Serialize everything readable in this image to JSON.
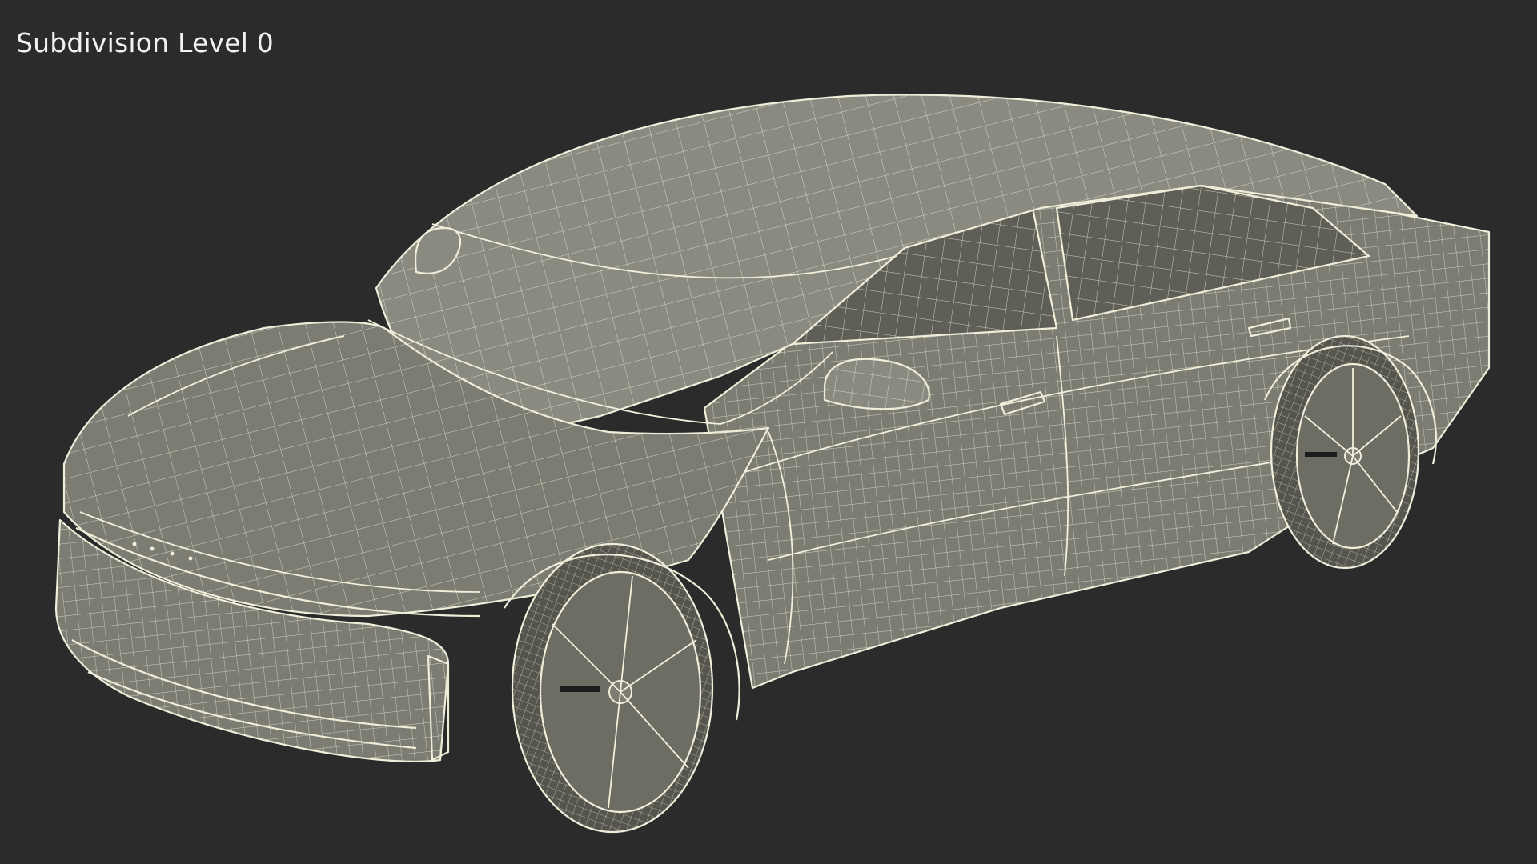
{
  "viewport": {
    "label": "Subdivision Level 0",
    "background_color": "#2b2b2b",
    "wire_color": "#eeeeda",
    "surface_color": "#7c7c72"
  }
}
